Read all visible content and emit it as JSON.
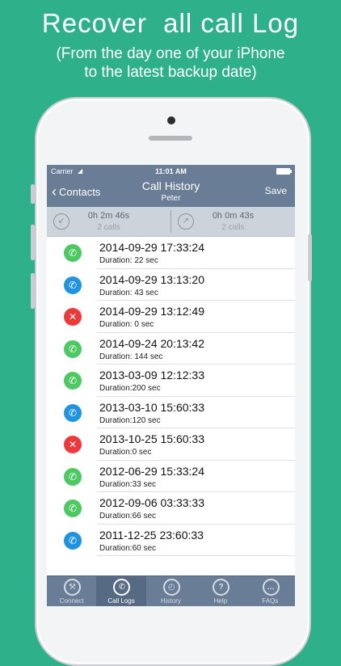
{
  "promo": {
    "title": "Recover  all call Log",
    "subtitle_line1": "(From the day one of your iPhone",
    "subtitle_line2": "to the latest backup date)"
  },
  "status": {
    "carrier": "Carrier",
    "time": "11:01 AM"
  },
  "nav": {
    "back_label": "Contacts",
    "title": "Call History",
    "subtitle": "Peter",
    "save_label": "Save"
  },
  "summary": [
    {
      "duration": "0h 2m 46s",
      "count": "2 calls"
    },
    {
      "duration": "0h 0m 43s",
      "count": "2 calls"
    }
  ],
  "calls": [
    {
      "datetime": "2014-09-29 17:33:24",
      "duration": "Duration: 22 sec",
      "type": "green"
    },
    {
      "datetime": "2014-09-29 13:13:20",
      "duration": "Duration: 43 sec",
      "type": "blue"
    },
    {
      "datetime": "2014-09-29 13:12:49",
      "duration": "Duration: 0 sec",
      "type": "red"
    },
    {
      "datetime": "2014-09-24 20:13:42",
      "duration": "Duration: 144 sec",
      "type": "green"
    },
    {
      "datetime": "2013-03-09 12:12:33",
      "duration": "Duration:200 sec",
      "type": "green"
    },
    {
      "datetime": "2013-03-10 15:60:33",
      "duration": "Duration:120 sec",
      "type": "blue"
    },
    {
      "datetime": "2013-10-25 15:60:33",
      "duration": "Duration:0 sec",
      "type": "red"
    },
    {
      "datetime": "2012-06-29 15:33:24",
      "duration": "Duration:33 sec",
      "type": "green"
    },
    {
      "datetime": "2012-09-06 03:33:33",
      "duration": "Duration:66 sec",
      "type": "green"
    },
    {
      "datetime": "2011-12-25 23:60:33",
      "duration": "Duration:60 sec",
      "type": "blue"
    }
  ],
  "tabs": [
    {
      "label": "Connect",
      "icon": "wrench-icon",
      "glyph": "⚒"
    },
    {
      "label": "Call Logs",
      "icon": "phone-icon",
      "glyph": "✆"
    },
    {
      "label": "History",
      "icon": "clock-icon",
      "glyph": "◴"
    },
    {
      "label": "Help",
      "icon": "question-icon",
      "glyph": "?"
    },
    {
      "label": "FAQs",
      "icon": "chat-icon",
      "glyph": "…"
    }
  ],
  "active_tab": 1,
  "colors": {
    "background": "#2eb08a",
    "navbar": "#6a7d96",
    "incoming": "#4cc961",
    "outgoing": "#1f93de",
    "missed": "#ec3a3a"
  }
}
